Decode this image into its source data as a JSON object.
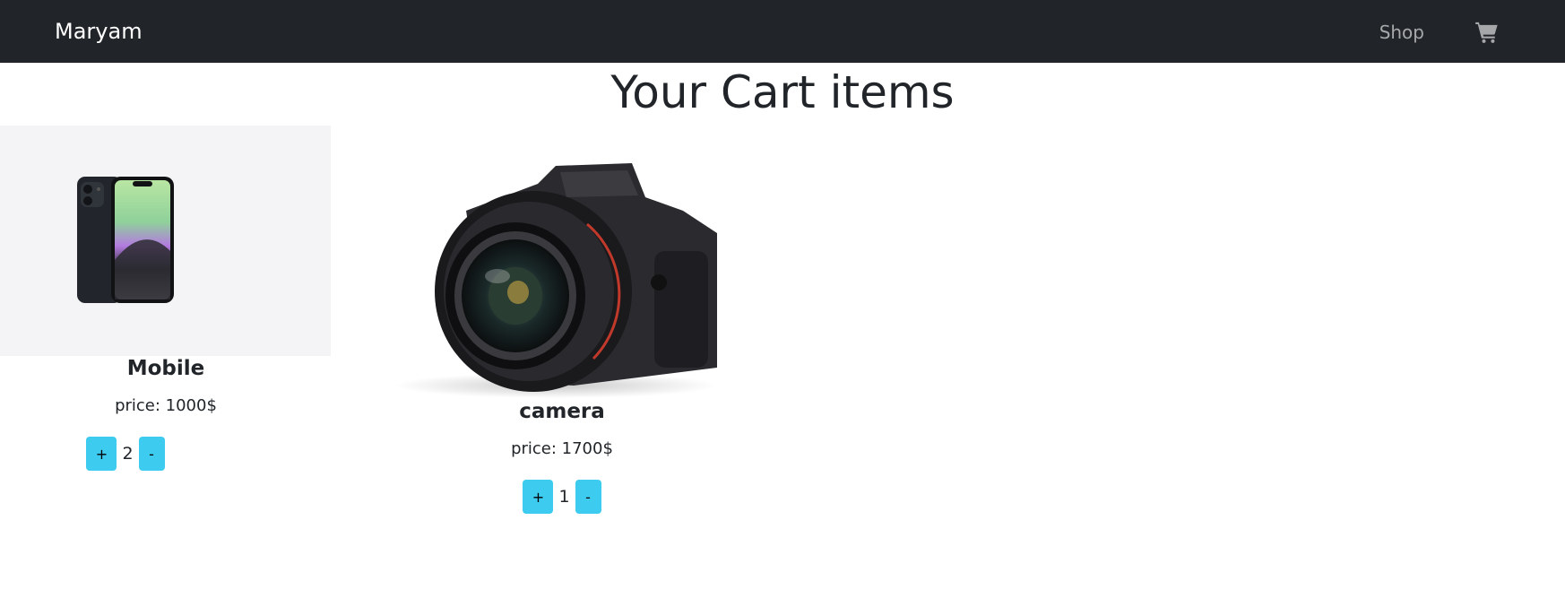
{
  "navbar": {
    "brand": "Maryam",
    "shop_link": "Shop",
    "cart_icon": "shopping-cart-icon",
    "background": "#212529"
  },
  "page": {
    "title": "Your Cart items"
  },
  "cart_items": [
    {
      "name": "Mobile",
      "price": "price: 1000$",
      "quantity": "2",
      "plus_label": "+",
      "minus_label": "-",
      "image_icon": "smartphone-image"
    },
    {
      "name": "camera",
      "price": "price: 1700$",
      "quantity": "1",
      "plus_label": "+",
      "minus_label": "-",
      "image_icon": "camera-image"
    }
  ],
  "colors": {
    "button": "#3dcbf0",
    "image_bg": "#f4f4f6"
  }
}
